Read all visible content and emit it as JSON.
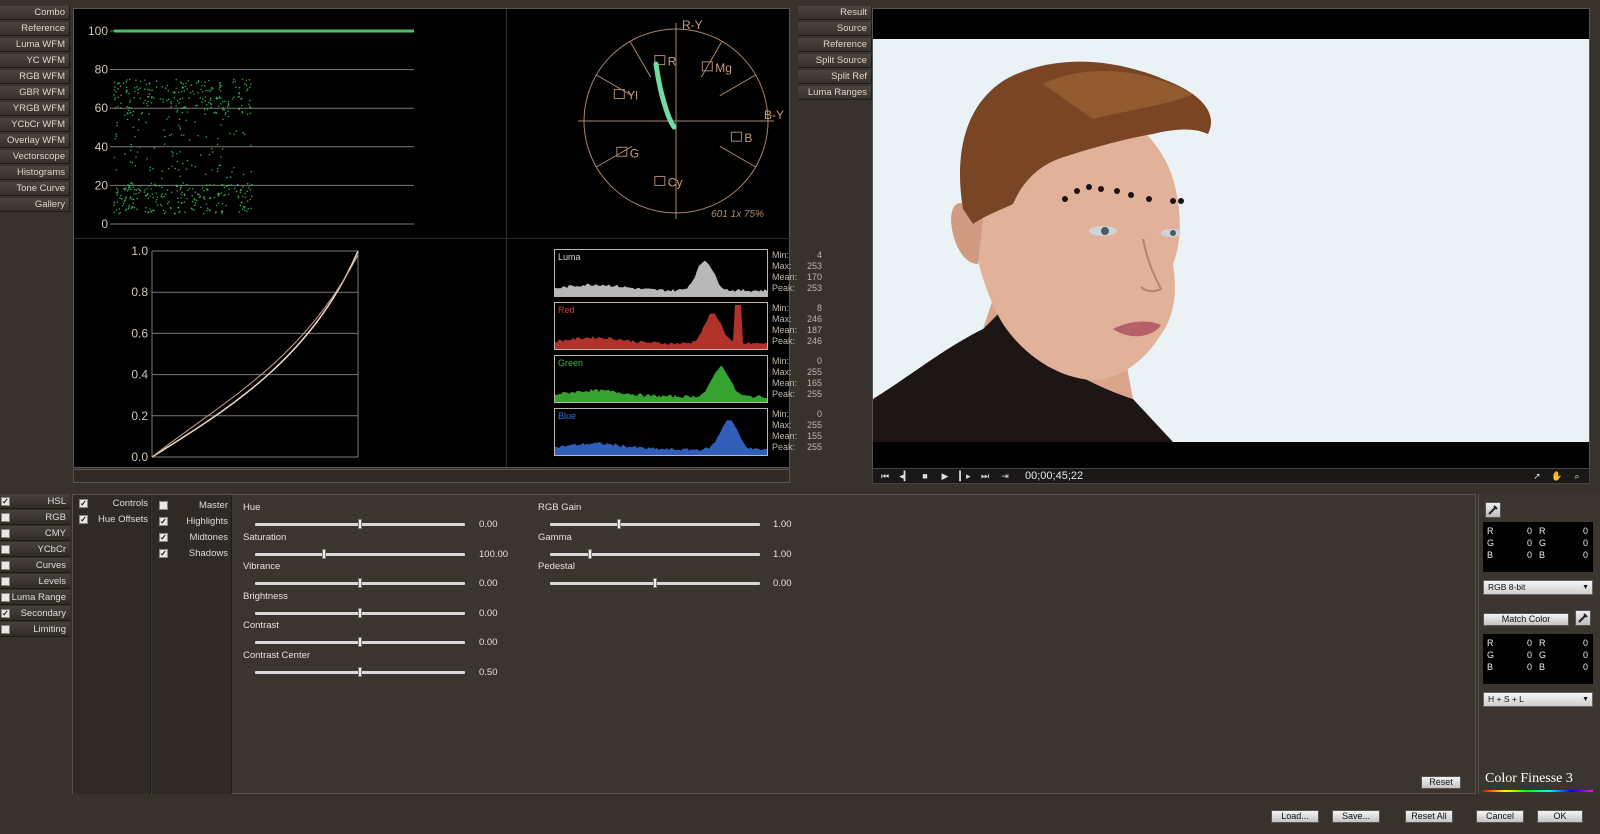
{
  "scope_modes": [
    "Combo",
    "Reference",
    "Luma WFM",
    "YC WFM",
    "RGB WFM",
    "GBR WFM",
    "YRGB WFM",
    "YCbCr WFM",
    "Overlay WFM",
    "Vectorscope",
    "Histograms",
    "Tone Curve",
    "Gallery"
  ],
  "view_modes": [
    "Result",
    "Source",
    "Reference",
    "Split Source",
    "Split Ref",
    "Luma Ranges"
  ],
  "waveform": {
    "ticks": [
      "100",
      "80",
      "60",
      "40",
      "20",
      "0"
    ]
  },
  "vectorscope": {
    "axis_labels": {
      "ry": "R-Y",
      "by": "B-Y"
    },
    "targets": [
      "R",
      "Mg",
      "B",
      "Cy",
      "G",
      "Yl"
    ],
    "info": "601 1x 75%"
  },
  "tone_curve": {
    "ticks": [
      "1.0",
      "0.8",
      "0.6",
      "0.4",
      "0.2",
      "0.0"
    ]
  },
  "histograms": [
    {
      "name": "Luma",
      "min": "4",
      "max": "253",
      "mean": "170",
      "peak": "253",
      "color": "#d8d8d8"
    },
    {
      "name": "Red",
      "min": "8",
      "max": "246",
      "mean": "187",
      "peak": "246",
      "color": "#d03a32"
    },
    {
      "name": "Green",
      "min": "0",
      "max": "255",
      "mean": "165",
      "peak": "255",
      "color": "#3fbf3a"
    },
    {
      "name": "Blue",
      "min": "0",
      "max": "255",
      "mean": "155",
      "peak": "255",
      "color": "#3a6ed8"
    }
  ],
  "stat_labels": {
    "min": "Min:",
    "max": "Max:",
    "mean": "Mean:",
    "peak": "Peak:"
  },
  "transport": {
    "timecode": "00;00;45;22"
  },
  "categories": [
    {
      "label": "HSL",
      "checked": true
    },
    {
      "label": "RGB",
      "checked": false
    },
    {
      "label": "CMY",
      "checked": false
    },
    {
      "label": "YCbCr",
      "checked": false
    },
    {
      "label": "Curves",
      "checked": false
    },
    {
      "label": "Levels",
      "checked": false
    },
    {
      "label": "Luma Range",
      "checked": false
    },
    {
      "label": "Secondary",
      "checked": true
    },
    {
      "label": "Limiting",
      "checked": false
    }
  ],
  "sub_tabs": [
    {
      "label": "Controls",
      "checked": true
    },
    {
      "label": "Hue Offsets",
      "checked": true
    }
  ],
  "tonal_ranges": [
    {
      "label": "Master",
      "checked": false
    },
    {
      "label": "Highlights",
      "checked": true
    },
    {
      "label": "Midtones",
      "checked": true
    },
    {
      "label": "Shadows",
      "checked": true
    }
  ],
  "sliders_left": [
    {
      "label": "Hue",
      "value": "0.00",
      "pos": 0.5
    },
    {
      "label": "Saturation",
      "value": "100.00",
      "pos": 0.33
    },
    {
      "label": "Vibrance",
      "value": "0.00",
      "pos": 0.5
    },
    {
      "label": "Brightness",
      "value": "0.00",
      "pos": 0.5
    },
    {
      "label": "Contrast",
      "value": "0.00",
      "pos": 0.5
    },
    {
      "label": "Contrast Center",
      "value": "0.50",
      "pos": 0.5
    }
  ],
  "sliders_right": [
    {
      "label": "RGB Gain",
      "value": "1.00",
      "pos": 0.33
    },
    {
      "label": "Gamma",
      "value": "1.00",
      "pos": 0.19
    },
    {
      "label": "Pedestal",
      "value": "0.00",
      "pos": 0.5
    }
  ],
  "info_box": {
    "r_label": "R",
    "g_label": "G",
    "b_label": "B",
    "r1": "0",
    "g1": "0",
    "b1": "0",
    "r2": "0",
    "g2": "0",
    "b2": "0"
  },
  "dropdown_1": "RGB 8-bit",
  "match_color_label": "Match Color",
  "dropdown_2": "H + S + L",
  "reset_label": "Reset",
  "brand": "Color Finesse 3",
  "bottom_buttons": {
    "load": "Load...",
    "save": "Save...",
    "reset_all": "Reset All",
    "cancel": "Cancel",
    "ok": "OK"
  }
}
